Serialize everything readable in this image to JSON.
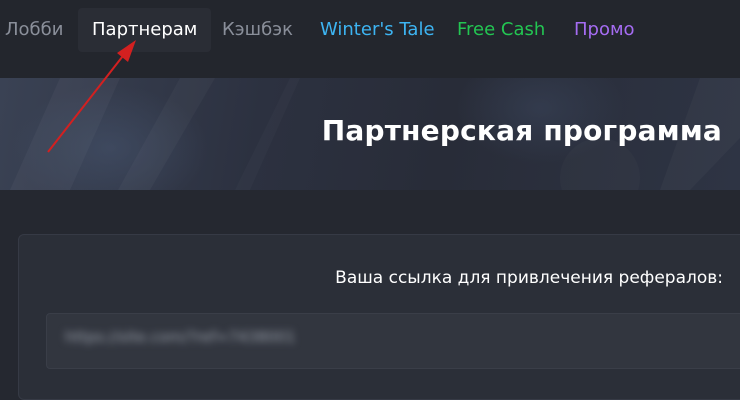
{
  "nav": {
    "items": [
      {
        "label": "Лобби",
        "color": "#8a8f9a"
      },
      {
        "label": "Партнерам",
        "color": "#ffffff",
        "active": true
      },
      {
        "label": "Кэшбэк",
        "color": "#8a8f9a"
      },
      {
        "label": "Winter's Tale",
        "color": "#3db4f2"
      },
      {
        "label": "Free Cash",
        "color": "#23c552"
      },
      {
        "label": "Промо",
        "color": "#a56cf2"
      }
    ]
  },
  "hero": {
    "title": "Партнерская программа"
  },
  "referral": {
    "label": "Ваша ссылка для привлечения рефералов:",
    "value": "https://site.com/?ref=7438001"
  },
  "colors": {
    "page_bg": "#252830",
    "nav_bg": "#23262d",
    "panel_bg": "#2b2f38",
    "input_bg": "#32363f",
    "annotation_arrow": "#d32020"
  }
}
